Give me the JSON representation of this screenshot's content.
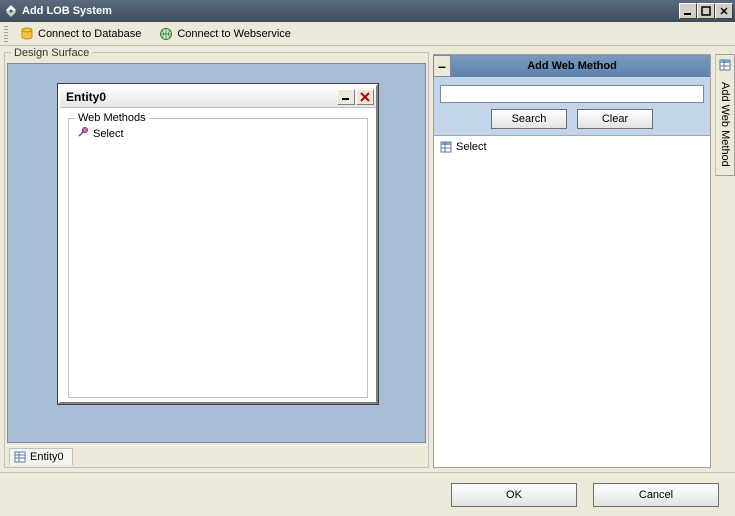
{
  "window": {
    "title": "Add LOB System"
  },
  "toolbar": {
    "connect_db": "Connect to Database",
    "connect_ws": "Connect to Webservice"
  },
  "design_surface": {
    "label": "Design Surface"
  },
  "entity": {
    "title": "Entity0",
    "web_methods_label": "Web Methods",
    "methods": [
      {
        "name": "Select"
      }
    ]
  },
  "status_tab": {
    "label": "Entity0"
  },
  "right_panel": {
    "title": "Add Web Method",
    "search_value": "",
    "search_btn": "Search",
    "clear_btn": "Clear",
    "items": [
      {
        "name": "Select"
      }
    ],
    "side_tab_label": "Add Web Method"
  },
  "footer": {
    "ok": "OK",
    "cancel": "Cancel"
  }
}
